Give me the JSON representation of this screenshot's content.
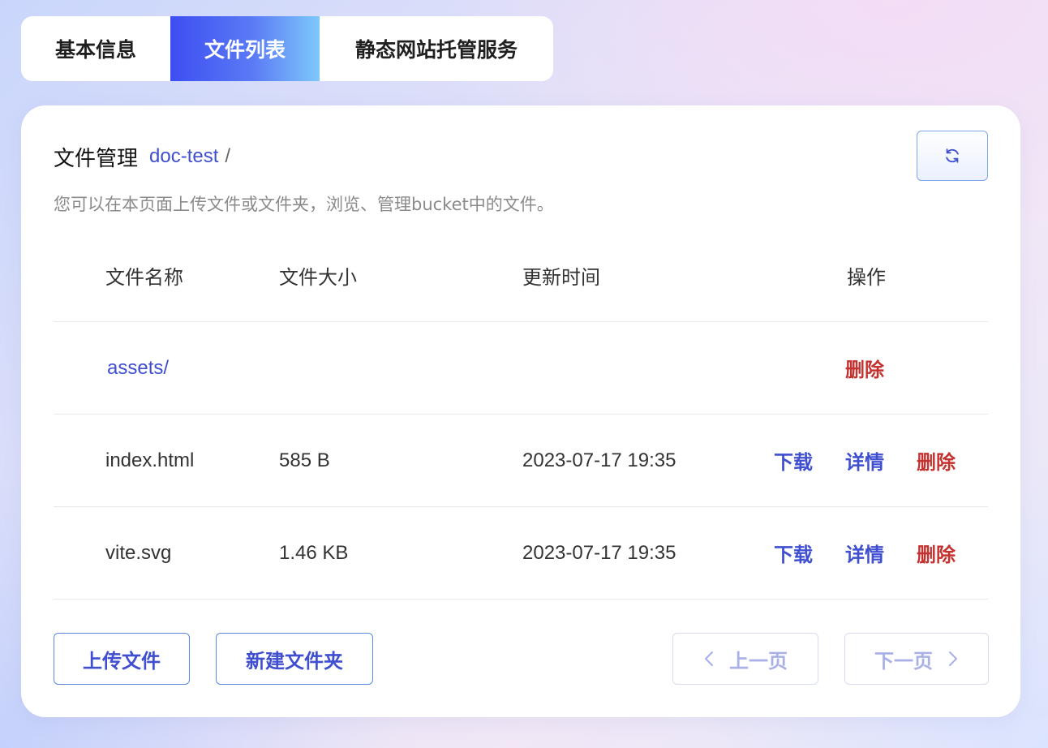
{
  "tabs": [
    {
      "label": "基本信息",
      "active": false
    },
    {
      "label": "文件列表",
      "active": true
    },
    {
      "label": "静态网站托管服务",
      "active": false
    }
  ],
  "header": {
    "title": "文件管理",
    "bucket": "doc-test",
    "path_separator": "/",
    "refresh_icon": "refresh-icon"
  },
  "description": "您可以在本页面上传文件或文件夹，浏览、管理bucket中的文件。",
  "table": {
    "columns": [
      "文件名称",
      "文件大小",
      "更新时间",
      "操作"
    ],
    "rows": [
      {
        "name": "assets/",
        "size": "",
        "updated": "",
        "type": "folder",
        "actions": [
          "删除"
        ]
      },
      {
        "name": "index.html",
        "size": "585 B",
        "updated": "2023-07-17 19:35",
        "type": "file",
        "actions": [
          "下载",
          "详情",
          "删除"
        ]
      },
      {
        "name": "vite.svg",
        "size": "1.46 KB",
        "updated": "2023-07-17 19:35",
        "type": "file",
        "actions": [
          "下载",
          "详情",
          "删除"
        ]
      }
    ]
  },
  "footer": {
    "upload_label": "上传文件",
    "new_folder_label": "新建文件夹",
    "prev_label": "上一页",
    "next_label": "下一页"
  },
  "colors": {
    "accent": "#3f4fd0",
    "danger": "#c4312f",
    "disabled": "#a9b0e6"
  }
}
